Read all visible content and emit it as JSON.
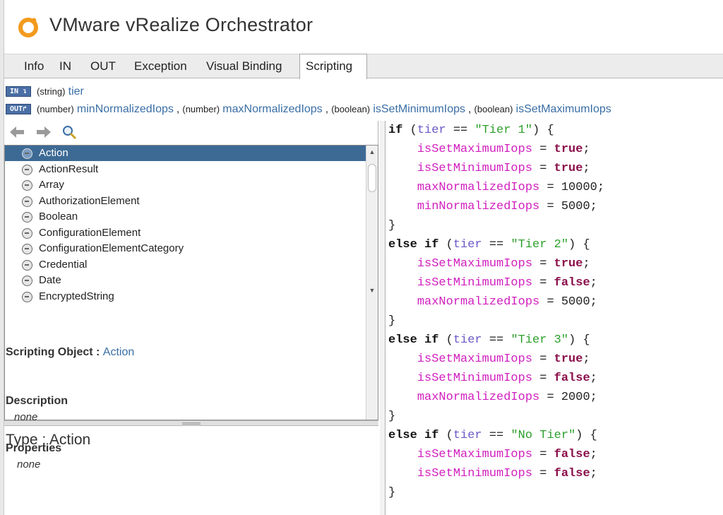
{
  "app": {
    "title": "VMware vRealize Orchestrator",
    "brand_color": "#f39a1e"
  },
  "tabs": [
    {
      "label": "Info",
      "active": false
    },
    {
      "label": "IN",
      "active": false
    },
    {
      "label": "OUT",
      "active": false
    },
    {
      "label": "Exception",
      "active": false
    },
    {
      "label": "Visual Binding",
      "active": false
    },
    {
      "label": "Scripting",
      "active": true
    }
  ],
  "in_params": {
    "badge": "IN ↴",
    "items": [
      {
        "type": "(string)",
        "name": "tier"
      }
    ]
  },
  "out_params": {
    "badge": "OUT↱",
    "items": [
      {
        "type": "(number)",
        "name": "minNormalizedIops"
      },
      {
        "type": "(number)",
        "name": "maxNormalizedIops"
      },
      {
        "type": "(boolean)",
        "name": "isSetMinimumIops"
      },
      {
        "type": "(boolean)",
        "name": "isSetMaximumIops"
      }
    ],
    "separator": " , "
  },
  "nav_toolbar": {
    "back_icon": "arrow-left-icon",
    "forward_icon": "arrow-right-icon",
    "search_icon": "search-icon"
  },
  "type_list": {
    "items": [
      "Action",
      "ActionResult",
      "Array",
      "AuthorizationElement",
      "Boolean",
      "ConfigurationElement",
      "ConfigurationElementCategory",
      "Credential",
      "Date",
      "EncryptedString"
    ],
    "selected_index": 0
  },
  "details": {
    "type_label": "Type : Action",
    "scripting_object_label": "Scripting Object :",
    "scripting_object_value": "Action",
    "description_label": "Description",
    "description_value": "none",
    "properties_label": "Properties",
    "properties_value": "none"
  },
  "code": {
    "lines": [
      [
        [
          "kw",
          "if"
        ],
        [
          "txt",
          " ("
        ],
        [
          "ident",
          "tier"
        ],
        [
          "txt",
          " == "
        ],
        [
          "str",
          "\"Tier 1\""
        ],
        [
          "txt",
          ") {"
        ]
      ],
      [
        [
          "txt",
          "    "
        ],
        [
          "var",
          "isSetMaximumIops"
        ],
        [
          "txt",
          " = "
        ],
        [
          "bool",
          "true"
        ],
        [
          "txt",
          ";"
        ]
      ],
      [
        [
          "txt",
          "    "
        ],
        [
          "var",
          "isSetMinimumIops"
        ],
        [
          "txt",
          " = "
        ],
        [
          "bool",
          "true"
        ],
        [
          "txt",
          ";"
        ]
      ],
      [
        [
          "txt",
          "    "
        ],
        [
          "var",
          "maxNormalizedIops"
        ],
        [
          "txt",
          " = "
        ],
        [
          "num",
          "10000"
        ],
        [
          "txt",
          ";"
        ]
      ],
      [
        [
          "txt",
          "    "
        ],
        [
          "var",
          "minNormalizedIops"
        ],
        [
          "txt",
          " = "
        ],
        [
          "num",
          "5000"
        ],
        [
          "txt",
          ";"
        ]
      ],
      [
        [
          "txt",
          "}"
        ]
      ],
      [
        [
          "kw",
          "else if"
        ],
        [
          "txt",
          " ("
        ],
        [
          "ident",
          "tier"
        ],
        [
          "txt",
          " == "
        ],
        [
          "str",
          "\"Tier 2\""
        ],
        [
          "txt",
          ") {"
        ]
      ],
      [
        [
          "txt",
          "    "
        ],
        [
          "var",
          "isSetMaximumIops"
        ],
        [
          "txt",
          " = "
        ],
        [
          "bool",
          "true"
        ],
        [
          "txt",
          ";"
        ]
      ],
      [
        [
          "txt",
          "    "
        ],
        [
          "var",
          "isSetMinimumIops"
        ],
        [
          "txt",
          " = "
        ],
        [
          "bool",
          "false"
        ],
        [
          "txt",
          ";"
        ]
      ],
      [
        [
          "txt",
          "    "
        ],
        [
          "var",
          "maxNormalizedIops"
        ],
        [
          "txt",
          " = "
        ],
        [
          "num",
          "5000"
        ],
        [
          "txt",
          ";"
        ]
      ],
      [
        [
          "txt",
          "}"
        ]
      ],
      [
        [
          "kw",
          "else if"
        ],
        [
          "txt",
          " ("
        ],
        [
          "ident",
          "tier"
        ],
        [
          "txt",
          " == "
        ],
        [
          "str",
          "\"Tier 3\""
        ],
        [
          "txt",
          ") {"
        ]
      ],
      [
        [
          "txt",
          "    "
        ],
        [
          "var",
          "isSetMaximumIops"
        ],
        [
          "txt",
          " = "
        ],
        [
          "bool",
          "true"
        ],
        [
          "txt",
          ";"
        ]
      ],
      [
        [
          "txt",
          "    "
        ],
        [
          "var",
          "isSetMinimumIops"
        ],
        [
          "txt",
          " = "
        ],
        [
          "bool",
          "false"
        ],
        [
          "txt",
          ";"
        ]
      ],
      [
        [
          "txt",
          "    "
        ],
        [
          "var",
          "maxNormalizedIops"
        ],
        [
          "txt",
          " = "
        ],
        [
          "num",
          "2000"
        ],
        [
          "txt",
          ";"
        ]
      ],
      [
        [
          "txt",
          "}"
        ]
      ],
      [
        [
          "kw",
          "else if"
        ],
        [
          "txt",
          " ("
        ],
        [
          "ident",
          "tier"
        ],
        [
          "txt",
          " == "
        ],
        [
          "str",
          "\"No Tier\""
        ],
        [
          "txt",
          ") {"
        ]
      ],
      [
        [
          "txt",
          "    "
        ],
        [
          "var",
          "isSetMaximumIops"
        ],
        [
          "txt",
          " = "
        ],
        [
          "bool",
          "false"
        ],
        [
          "txt",
          ";"
        ]
      ],
      [
        [
          "txt",
          "    "
        ],
        [
          "var",
          "isSetMinimumIops"
        ],
        [
          "txt",
          " = "
        ],
        [
          "bool",
          "false"
        ],
        [
          "txt",
          ";"
        ]
      ],
      [
        [
          "txt",
          "}"
        ]
      ]
    ]
  },
  "colors": {
    "selection": "#3d6a95",
    "param_name": "#3a6ea5",
    "code_variable": "#d11fbf",
    "code_identifier": "#6a5ac8",
    "code_string": "#2ea02e",
    "code_boolean": "#8a0f4a"
  }
}
